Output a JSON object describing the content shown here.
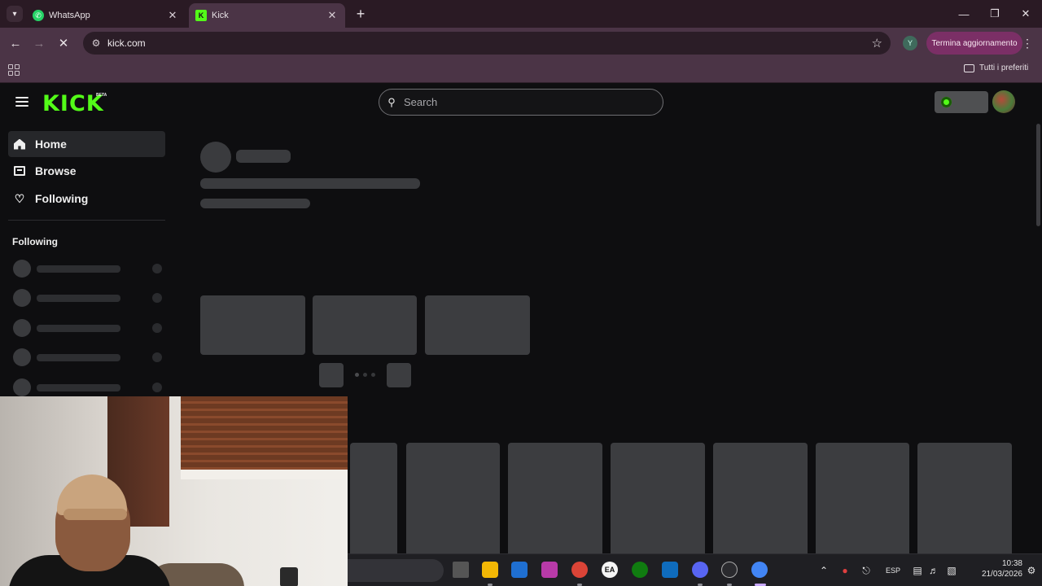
{
  "browser": {
    "tabs": [
      {
        "title": "WhatsApp",
        "active": false
      },
      {
        "title": "Kick",
        "active": true
      }
    ],
    "address": "kick.com",
    "update_button": "Termina aggiornamento",
    "profile_initial": "Y",
    "bookmark_folder": "Tutti i preferiti"
  },
  "kick": {
    "logo": "KICK",
    "logo_badge": "BETA",
    "search_placeholder": "Search",
    "brand_color": "#53fc18",
    "nav": [
      {
        "label": "Home",
        "icon": "home-icon",
        "active": true
      },
      {
        "label": "Browse",
        "icon": "browse-icon",
        "active": false
      },
      {
        "label": "Following",
        "icon": "heart-icon",
        "active": false
      }
    ],
    "following_section_title": "Following"
  },
  "taskbar": {
    "language": "ESP",
    "time": "10:38",
    "date": "21/03/2026",
    "apps": [
      "task-view-icon",
      "file-explorer-icon",
      "microsoft-store-icon",
      "instagram-icon",
      "chrome-icon",
      "ea-app-icon",
      "xbox-icon",
      "outlook-icon",
      "discord-icon",
      "clock-app-icon",
      "chrome-active-icon"
    ]
  }
}
